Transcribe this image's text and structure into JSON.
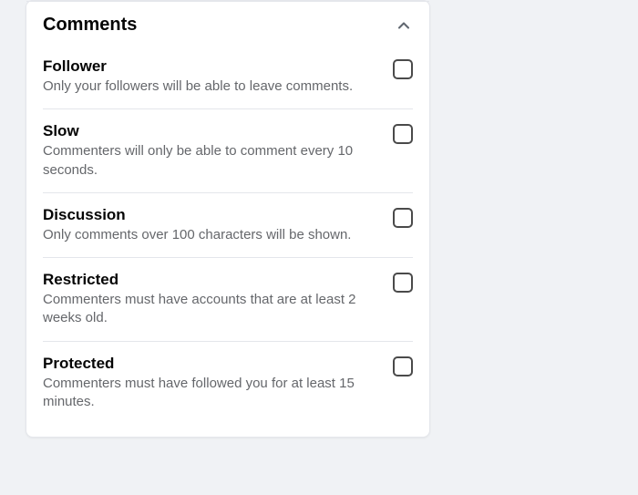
{
  "section": {
    "title": "Comments"
  },
  "options": [
    {
      "title": "Follower",
      "desc": "Only your followers will be able to leave comments."
    },
    {
      "title": "Slow",
      "desc": "Commenters will only be able to comment every 10 seconds."
    },
    {
      "title": "Discussion",
      "desc": "Only comments over 100 characters will be shown."
    },
    {
      "title": "Restricted",
      "desc": "Commenters must have accounts that are at least 2 weeks old."
    },
    {
      "title": "Protected",
      "desc": "Commenters must have followed you for at least 15 minutes."
    }
  ]
}
